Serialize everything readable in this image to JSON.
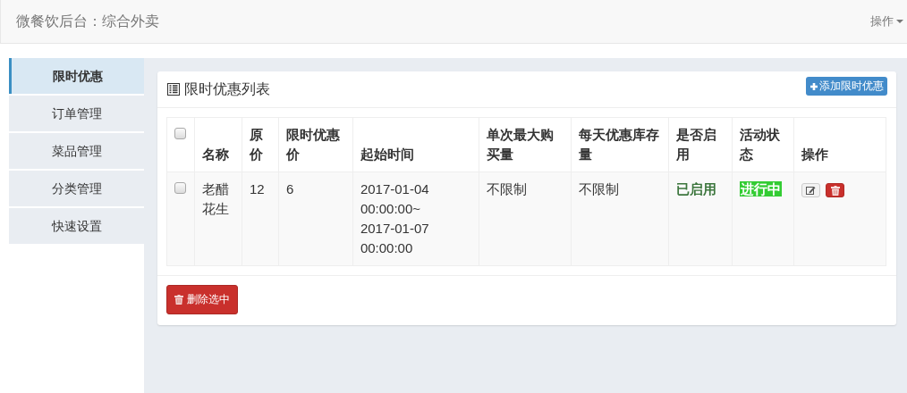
{
  "navbar": {
    "title": "微餐饮后台：综合外卖",
    "menu": "操作"
  },
  "sidebar": {
    "items": [
      {
        "label": "限时优惠",
        "selected": true
      },
      {
        "label": "订单管理",
        "selected": false
      },
      {
        "label": "菜品管理",
        "selected": false
      },
      {
        "label": "分类管理",
        "selected": false
      },
      {
        "label": "快速设置",
        "selected": false
      }
    ]
  },
  "panel": {
    "title": "限时优惠列表",
    "add_button": "添加限时优惠",
    "table": {
      "select_all": false,
      "columns": [
        "名称",
        "原价",
        "限时优惠价",
        "起始时间",
        "单次最大购买量",
        "每天优惠库存量",
        "是否启用",
        "活动状态",
        "操作"
      ],
      "rows": [
        {
          "checked": false,
          "name": "老醋花生",
          "price": "12",
          "sale_price": "6",
          "time": "2017-01-04 00:00:00~2017-01-07 00:00:00",
          "max_per_order": "不限制",
          "daily_stock": "不限制",
          "enabled": true,
          "enabled_text": "已启用",
          "active": true,
          "status_text": "进行中"
        }
      ]
    },
    "delete_button": "删除选中"
  }
}
